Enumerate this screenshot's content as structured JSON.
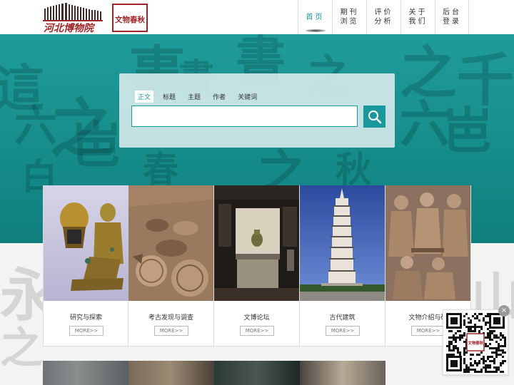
{
  "header": {
    "logo_text": "河北博物院",
    "seal_text": "文物春秋",
    "nav": [
      {
        "line1": "首页",
        "line2": "",
        "active": true
      },
      {
        "line1": "期刊",
        "line2": "浏览",
        "active": false
      },
      {
        "line1": "评价",
        "line2": "分析",
        "active": false
      },
      {
        "line1": "关于",
        "line2": "我们",
        "active": false
      },
      {
        "line1": "后台",
        "line2": "登录",
        "active": false
      }
    ]
  },
  "search": {
    "tabs": [
      "正文",
      "标题",
      "主题",
      "作者",
      "关键词"
    ],
    "active_tab": "正文",
    "value": "",
    "placeholder": "",
    "icon": "search-icon"
  },
  "cards": [
    {
      "title": "研究与探索",
      "more": "MORE>>"
    },
    {
      "title": "考古发现与调查",
      "more": "MORE>>"
    },
    {
      "title": "文博论坛",
      "more": "MORE>>"
    },
    {
      "title": "古代建筑",
      "more": "MORE>>"
    },
    {
      "title": "文物介绍与研",
      "more": "MORE>>"
    }
  ],
  "qr": {
    "close_label": "×",
    "seal_text": "文物春秋"
  },
  "colors": {
    "accent": "#19999b",
    "banner": "#168d8b",
    "logo_red": "#a0262a"
  }
}
